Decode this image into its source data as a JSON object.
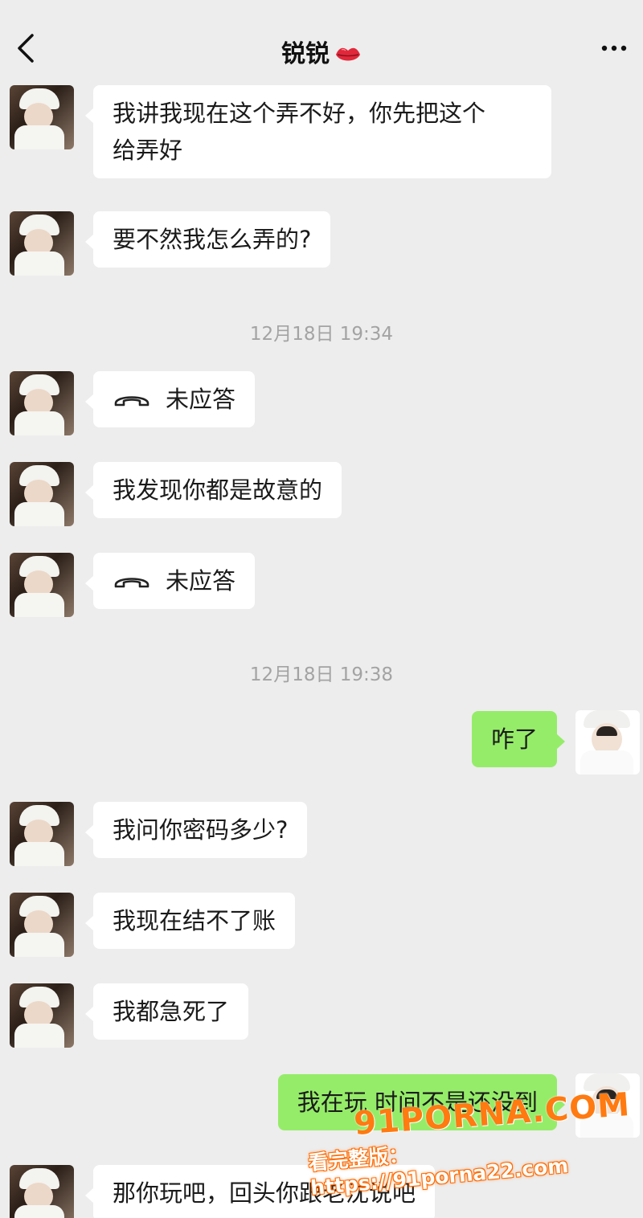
{
  "header": {
    "title": "锐锐",
    "icons": [
      "back-icon",
      "lips-icon",
      "more-icon"
    ]
  },
  "messages": {
    "m1": {
      "text": "我讲我现在这个弄不好，你先把这个给弄好",
      "line1": "我讲我现在这个弄不好，你先把这个",
      "line2": "给弄好"
    },
    "m2": {
      "text": "要不然我怎么弄的?"
    },
    "ts1": {
      "text": "12月18日 19:34"
    },
    "m3": {
      "text": "未应答"
    },
    "m4": {
      "text": "我发现你都是故意的"
    },
    "m5": {
      "text": "未应答"
    },
    "ts2": {
      "text": "12月18日 19:38"
    },
    "m6": {
      "text": "咋了"
    },
    "m7": {
      "text": "我问你密码多少?"
    },
    "m8": {
      "text": "我现在结不了账"
    },
    "m9": {
      "text": "我都急死了"
    },
    "m10": {
      "text": "我在玩 时间不是还没到"
    },
    "m11": {
      "text": "那你玩吧，回头你跟老沈说吧"
    }
  },
  "watermark": {
    "logo": "91PORNA.COM",
    "url_text": "看完整版：https://91porna22.com"
  },
  "colors": {
    "background": "#ededed",
    "outgoing_bubble": "#95ec69",
    "incoming_bubble": "#ffffff",
    "timestamp": "#a3a3a3",
    "watermark": "#ff7a10"
  }
}
